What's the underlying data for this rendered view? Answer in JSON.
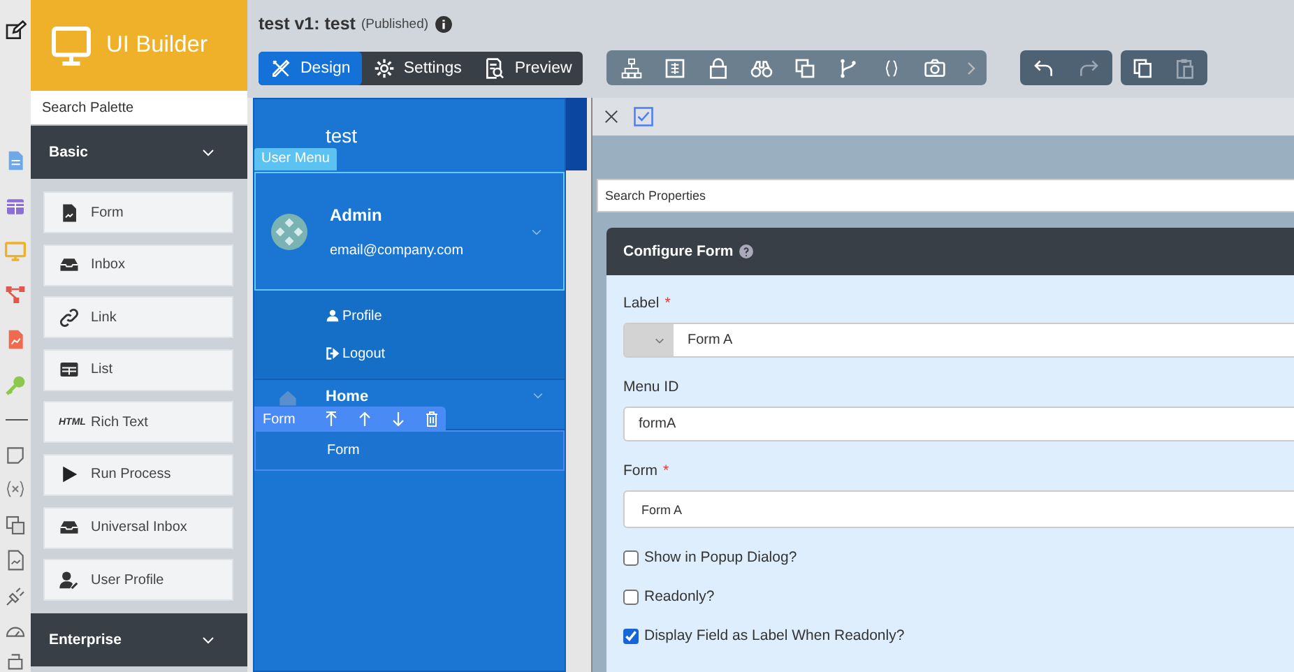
{
  "palette": {
    "title": "UI Builder",
    "search": {
      "placeholder": "Search Palette"
    },
    "sections": [
      {
        "label": "Basic",
        "expanded": true,
        "items": [
          {
            "label": "Form"
          },
          {
            "label": "Inbox"
          },
          {
            "label": "Link"
          },
          {
            "label": "List"
          },
          {
            "label": "Rich Text",
            "badge": "HTML"
          },
          {
            "label": "Run Process"
          },
          {
            "label": "Universal Inbox"
          },
          {
            "label": "User Profile"
          }
        ]
      },
      {
        "label": "Enterprise",
        "expanded": false
      }
    ]
  },
  "header": {
    "title": "test v1: test",
    "status": "(Published)"
  },
  "mode_tabs": [
    {
      "label": "Design",
      "selected": true
    },
    {
      "label": "Settings",
      "selected": false
    },
    {
      "label": "Preview",
      "selected": false
    }
  ],
  "menu_preview": {
    "title": "test",
    "tag": "User Menu",
    "user": {
      "name": "Admin",
      "email": "email@company.com"
    },
    "user_links": [
      "Profile",
      "Logout"
    ],
    "category": "Home",
    "item_toolbar": {
      "label": "Form"
    },
    "items": [
      {
        "label": "Form",
        "selected": true
      }
    ]
  },
  "properties": {
    "search": {
      "placeholder": "Search Properties"
    },
    "title": "Configure Form",
    "fields": [
      {
        "kind": "select-text",
        "label": "Label",
        "mark": "*",
        "value": "Form A"
      },
      {
        "kind": "text",
        "label": "Menu ID",
        "value": "formA"
      },
      {
        "kind": "select",
        "label": "Form",
        "mark": "*",
        "value": "Form A"
      },
      {
        "kind": "checkbox",
        "label": "Show in Popup Dialog?",
        "checked": false
      },
      {
        "kind": "checkbox",
        "label": "Readonly?",
        "checked": false
      },
      {
        "kind": "checkbox",
        "label": "Display Field as Label When Readonly?",
        "checked": true
      }
    ]
  }
}
